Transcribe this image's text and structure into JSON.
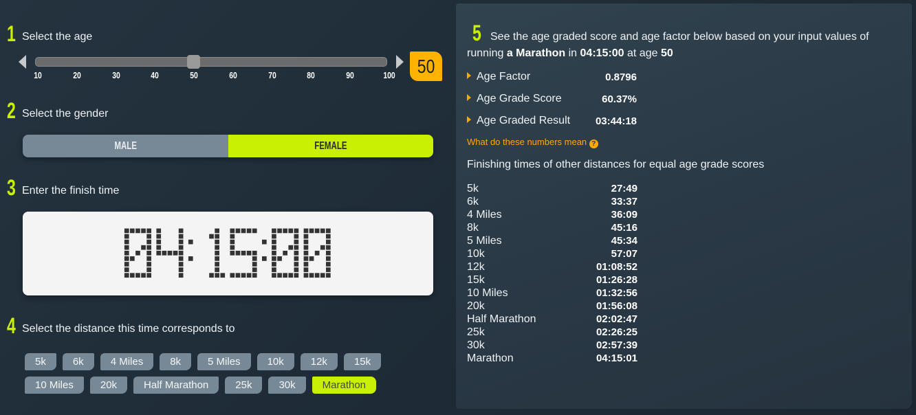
{
  "steps": {
    "age": {
      "number": "1",
      "label": "Select the age"
    },
    "gender": {
      "number": "2",
      "label": "Select the gender"
    },
    "time": {
      "number": "3",
      "label": "Enter the finish time"
    },
    "distance": {
      "number": "4",
      "label": "Select the distance this time corresponds to"
    },
    "results": {
      "number": "5"
    }
  },
  "age_slider": {
    "min": 10,
    "max": 100,
    "value": 50,
    "ticks": [
      "10",
      "20",
      "30",
      "40",
      "50",
      "60",
      "70",
      "80",
      "90",
      "100"
    ],
    "display_value": "50",
    "colors": {
      "badge": "#ffb300"
    }
  },
  "gender": {
    "options": [
      "MALE",
      "FEMALE"
    ],
    "selected": "FEMALE"
  },
  "finish_time": {
    "value": "04:15:00"
  },
  "distances": {
    "rows": [
      [
        "5k",
        "6k",
        "4 Miles",
        "8k",
        "5 Miles",
        "10k",
        "12k",
        "15k"
      ],
      [
        "10 Miles",
        "20k",
        "Half Marathon",
        "25k",
        "30k",
        "Marathon"
      ]
    ],
    "selected": "Marathon"
  },
  "results": {
    "intro_prefix": "See the age graded score and age factor below based on your input values of running ",
    "intro_distance": "a Marathon",
    "intro_in": " in ",
    "intro_time": "04:15:00",
    "intro_at_age": " at age ",
    "intro_age": "50",
    "metrics": [
      {
        "label": "Age Factor",
        "value": "0.8796"
      },
      {
        "label": "Age Grade Score",
        "value": "60.37%"
      },
      {
        "label": "Age Graded Result",
        "value": "03:44:18"
      }
    ],
    "help_link": "What do these numbers mean",
    "help_icon": "?",
    "equivalents_title": "Finishing times of other distances for equal age grade scores",
    "equivalents": [
      {
        "distance": "5k",
        "time": "27:49"
      },
      {
        "distance": "6k",
        "time": "33:37"
      },
      {
        "distance": "4 Miles",
        "time": "36:09"
      },
      {
        "distance": "8k",
        "time": "45:16"
      },
      {
        "distance": "5 Miles",
        "time": "45:34"
      },
      {
        "distance": "10k",
        "time": "57:07"
      },
      {
        "distance": "12k",
        "time": "01:08:52"
      },
      {
        "distance": "15k",
        "time": "01:26:28"
      },
      {
        "distance": "10 Miles",
        "time": "01:32:56"
      },
      {
        "distance": "20k",
        "time": "01:56:08"
      },
      {
        "distance": "Half Marathon",
        "time": "02:02:47"
      },
      {
        "distance": "25k",
        "time": "02:26:25"
      },
      {
        "distance": "30k",
        "time": "02:57:39"
      },
      {
        "distance": "Marathon",
        "time": "04:15:01"
      }
    ]
  }
}
